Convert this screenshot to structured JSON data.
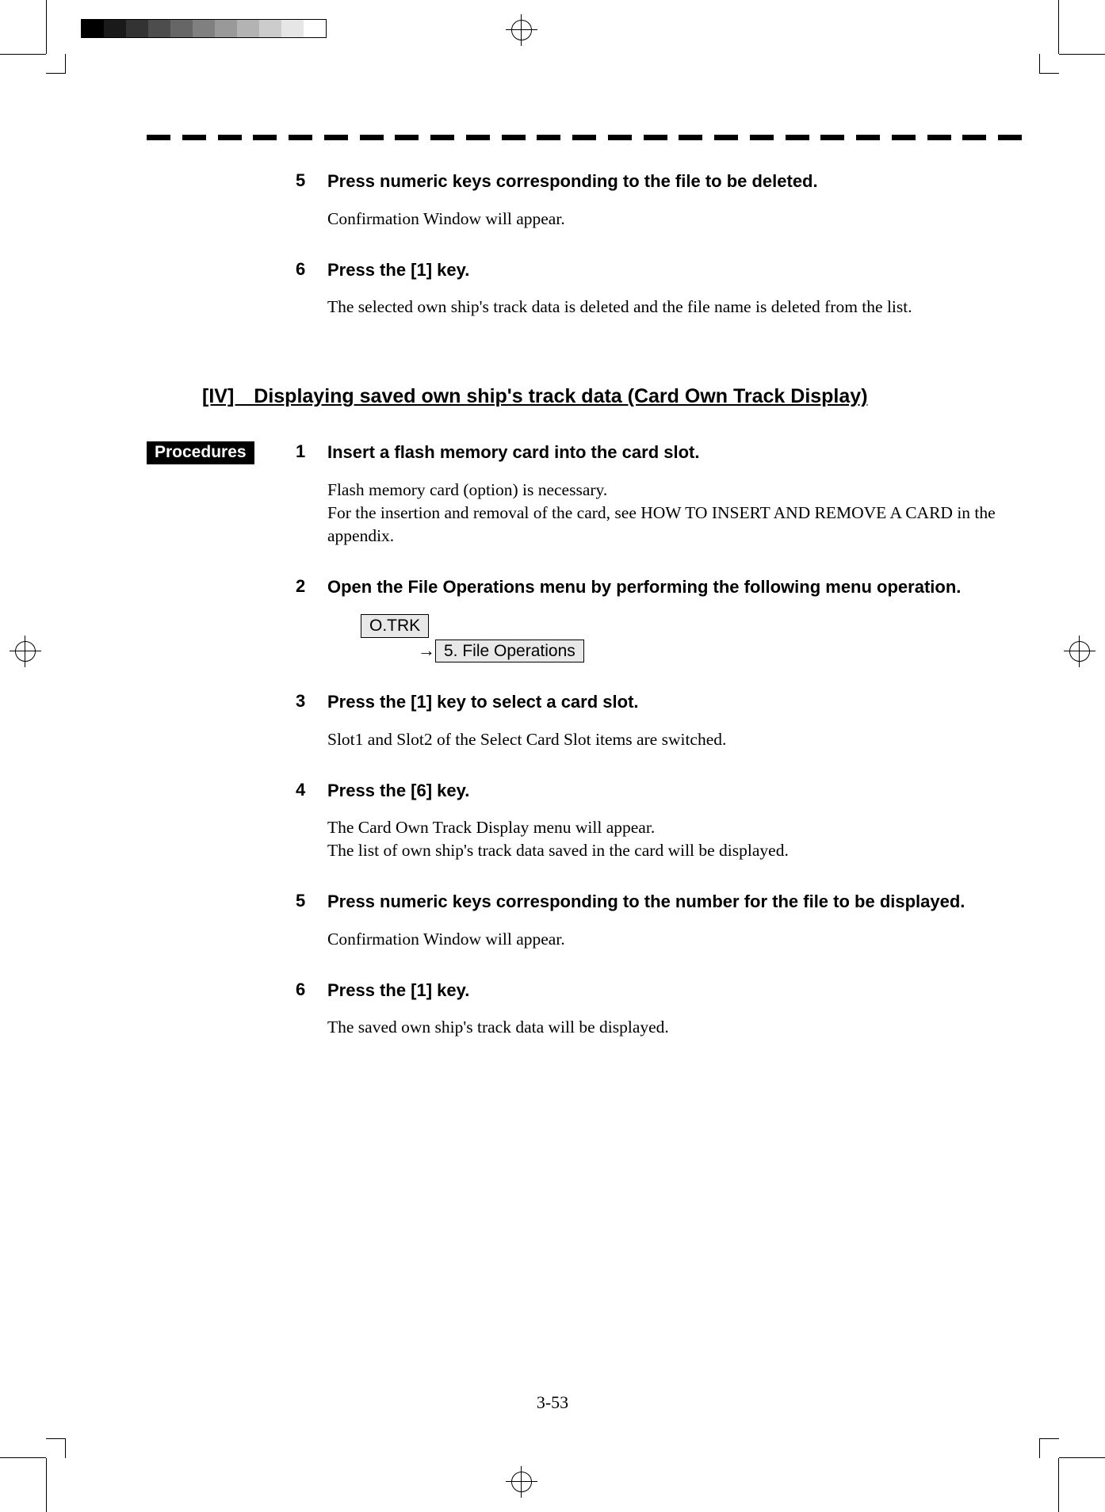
{
  "top_steps": [
    {
      "num": "5",
      "title": "Press numeric keys corresponding to the file to be deleted.",
      "body": "Confirmation Window will appear."
    },
    {
      "num": "6",
      "title": "Press the [1] key.",
      "body": "The selected own ship's track data is deleted and the file name is deleted from the list."
    }
  ],
  "section_heading": "[IV] Displaying saved own ship's track data (Card Own Track Display)",
  "procedures_label": "Procedures",
  "menu_path": {
    "root": "O.TRK",
    "arrow": "→",
    "child": "5. File Operations"
  },
  "procedure_steps": [
    {
      "num": "1",
      "title": "Insert a flash memory card into the card slot.",
      "body_lines": [
        "Flash memory card (option) is necessary.",
        "For the insertion and removal of the card, see HOW TO INSERT AND REMOVE A CARD in the appendix."
      ]
    },
    {
      "num": "2",
      "title": "Open the File Operations menu by performing the following menu operation.",
      "has_menu_path": true
    },
    {
      "num": "3",
      "title": "Press the [1] key to select a card slot.",
      "body_lines": [
        "Slot1 and Slot2 of the Select Card Slot items are switched."
      ]
    },
    {
      "num": "4",
      "title": "Press the [6] key.",
      "body_lines": [
        "The Card Own Track Display menu will appear.",
        "The list of own ship's track data saved in the card will be displayed."
      ]
    },
    {
      "num": "5",
      "title": "Press numeric keys corresponding to the number for the file to be displayed.",
      "body_lines": [
        "Confirmation Window will appear."
      ]
    },
    {
      "num": "6",
      "title": "Press the [1] key.",
      "body_lines": [
        "The saved own ship's track data will be displayed."
      ]
    }
  ],
  "page_number": "3-53",
  "grayscale_shades": [
    "#000000",
    "#1a1a1a",
    "#333333",
    "#4d4d4d",
    "#666666",
    "#808080",
    "#999999",
    "#b3b3b3",
    "#cccccc",
    "#e6e6e6",
    "#ffffff"
  ]
}
